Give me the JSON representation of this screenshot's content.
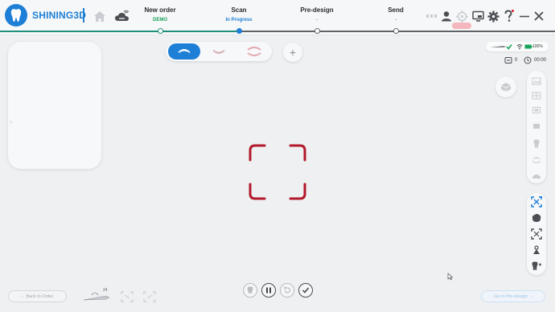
{
  "app": {
    "brand": "SHINING3D",
    "brand_color": "#1d7fd6"
  },
  "steps": [
    {
      "title": "New order",
      "sub": "DEMO",
      "state": "done"
    },
    {
      "title": "Scan",
      "sub": "In Progress",
      "state": "active"
    },
    {
      "title": "Pre-design",
      "sub": "-",
      "state": "pending"
    },
    {
      "title": "Send",
      "sub": "-",
      "state": "pending"
    }
  ],
  "status": {
    "battery": "100%",
    "scan_count": "0",
    "timer": "00:00"
  },
  "bottom": {
    "back_label": "Back to Order",
    "goto_label": "Go to Pre-design",
    "scanner_badge": "24"
  },
  "colors": {
    "active_step": "#1d7fd6",
    "done_step": "#19a35b",
    "scan_frame": "#b3192a",
    "background": "#eef0f2"
  },
  "icons": {
    "home": "home-icon",
    "cloud": "cloud-wifi-icon",
    "user": "user-icon",
    "target": "target-icon",
    "screen": "screen-share-icon",
    "settings": "gear-icon",
    "help": "help-icon",
    "minimize": "minimize-icon",
    "close": "close-icon"
  }
}
